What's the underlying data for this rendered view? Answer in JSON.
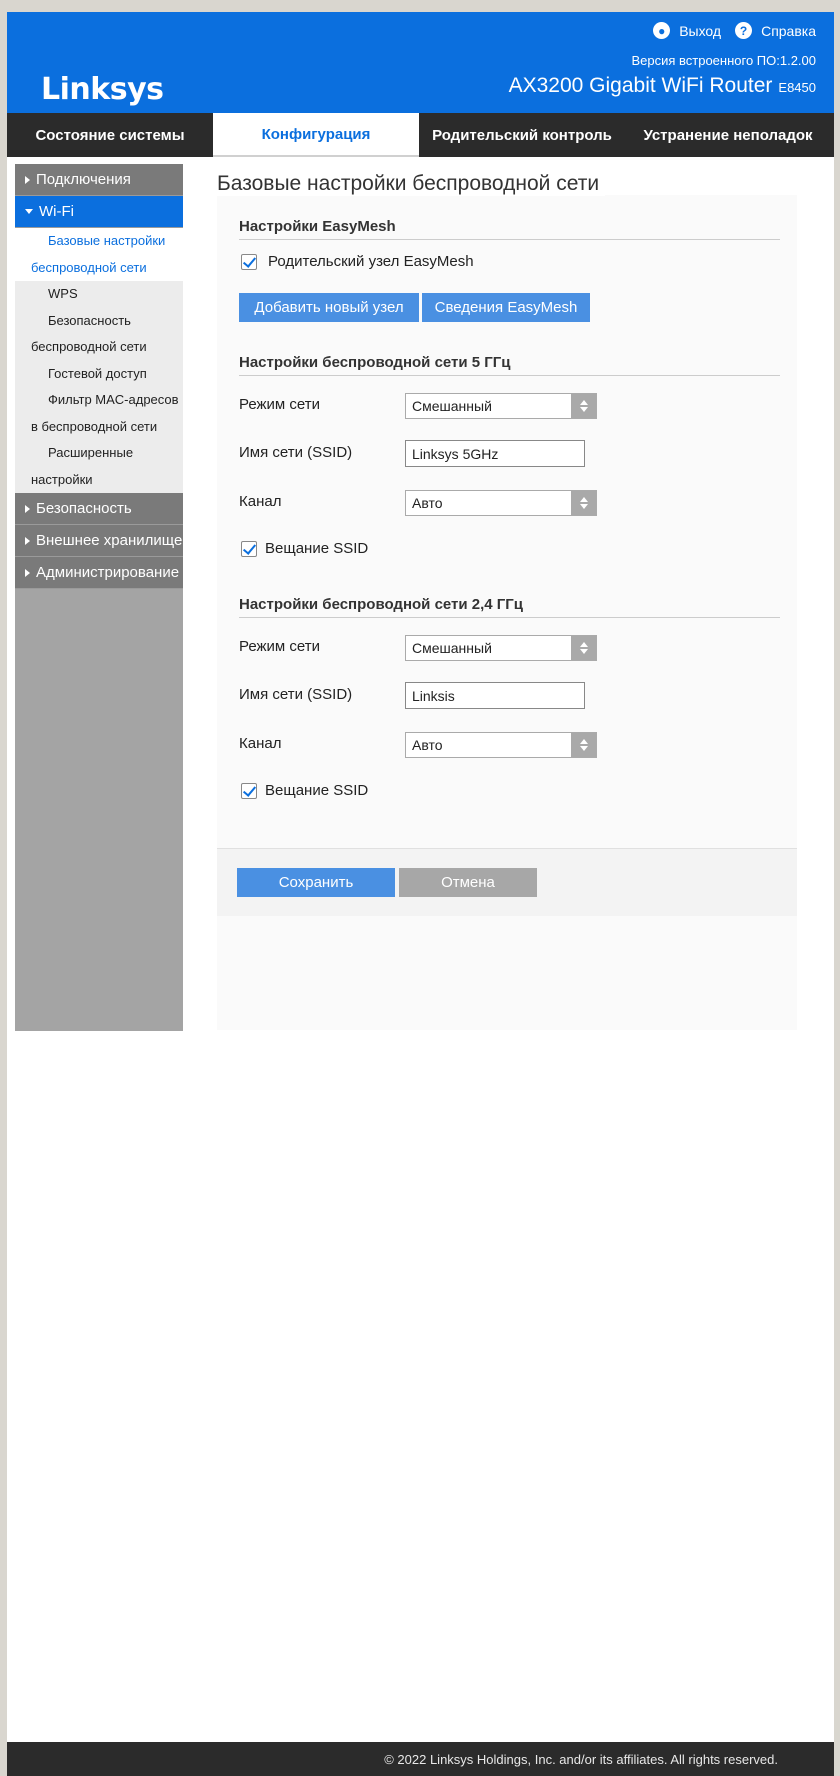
{
  "header": {
    "brand": "Linksys",
    "logout_label": "Выход",
    "help_label": "Справка",
    "firmware": "Версия встроенного ПО:1.2.00",
    "model": "AX3200 Gigabit WiFi Router",
    "sku": "E8450"
  },
  "tabs": [
    {
      "label": "Состояние системы"
    },
    {
      "label": "Конфигурация"
    },
    {
      "label": "Родительский контроль"
    },
    {
      "label": "Устранение неполадок"
    }
  ],
  "sidebar": {
    "connections": "Подключения",
    "wifi": "Wi-Fi",
    "wifi_items": [
      {
        "line1": "Базовые настройки",
        "line2": "беспроводной сети"
      },
      {
        "line1": "WPS",
        "line2": ""
      },
      {
        "line1": "Безопасность",
        "line2": "беспроводной сети"
      },
      {
        "line1": "Гостевой доступ",
        "line2": ""
      },
      {
        "line1": "Фильтр MAC-адресов",
        "line2": "в беспроводной сети"
      },
      {
        "line1": "Расширенные",
        "line2": "настройки"
      }
    ],
    "security": "Безопасность",
    "storage": "Внешнее хранилище",
    "admin": "Администрирование"
  },
  "main": {
    "title": "Базовые настройки беспроводной сети",
    "easymesh": {
      "title": "Настройки EasyMesh",
      "parent_node": "Родительский узел EasyMesh",
      "add_node": "Добавить новый узел",
      "details": "Сведения EasyMesh"
    },
    "band5": {
      "title": "Настройки беспроводной сети 5 ГГц",
      "mode_label": "Режим сети",
      "mode_value": "Смешанный",
      "ssid_label": "Имя сети (SSID)",
      "ssid_value": "Linksys 5GHz",
      "channel_label": "Канал",
      "channel_value": "Авто",
      "broadcast_label": "Вещание SSID"
    },
    "band24": {
      "title": "Настройки беспроводной сети 2,4 ГГц",
      "mode_label": "Режим сети",
      "mode_value": "Смешанный",
      "ssid_label": "Имя сети (SSID)",
      "ssid_value": "Linksis",
      "channel_label": "Канал",
      "channel_value": "Авто",
      "broadcast_label": "Вещание SSID"
    },
    "save": "Сохранить",
    "cancel": "Отмена"
  },
  "footer": {
    "copyright": "© 2022 Linksys Holdings, Inc. and/or its affiliates. All rights reserved."
  },
  "colors": {
    "brand_blue": "#0b6fde",
    "button_blue": "#4a90e2",
    "dark_bar": "#2b2b2b",
    "sidebar_gray": "#7a7a7a"
  }
}
